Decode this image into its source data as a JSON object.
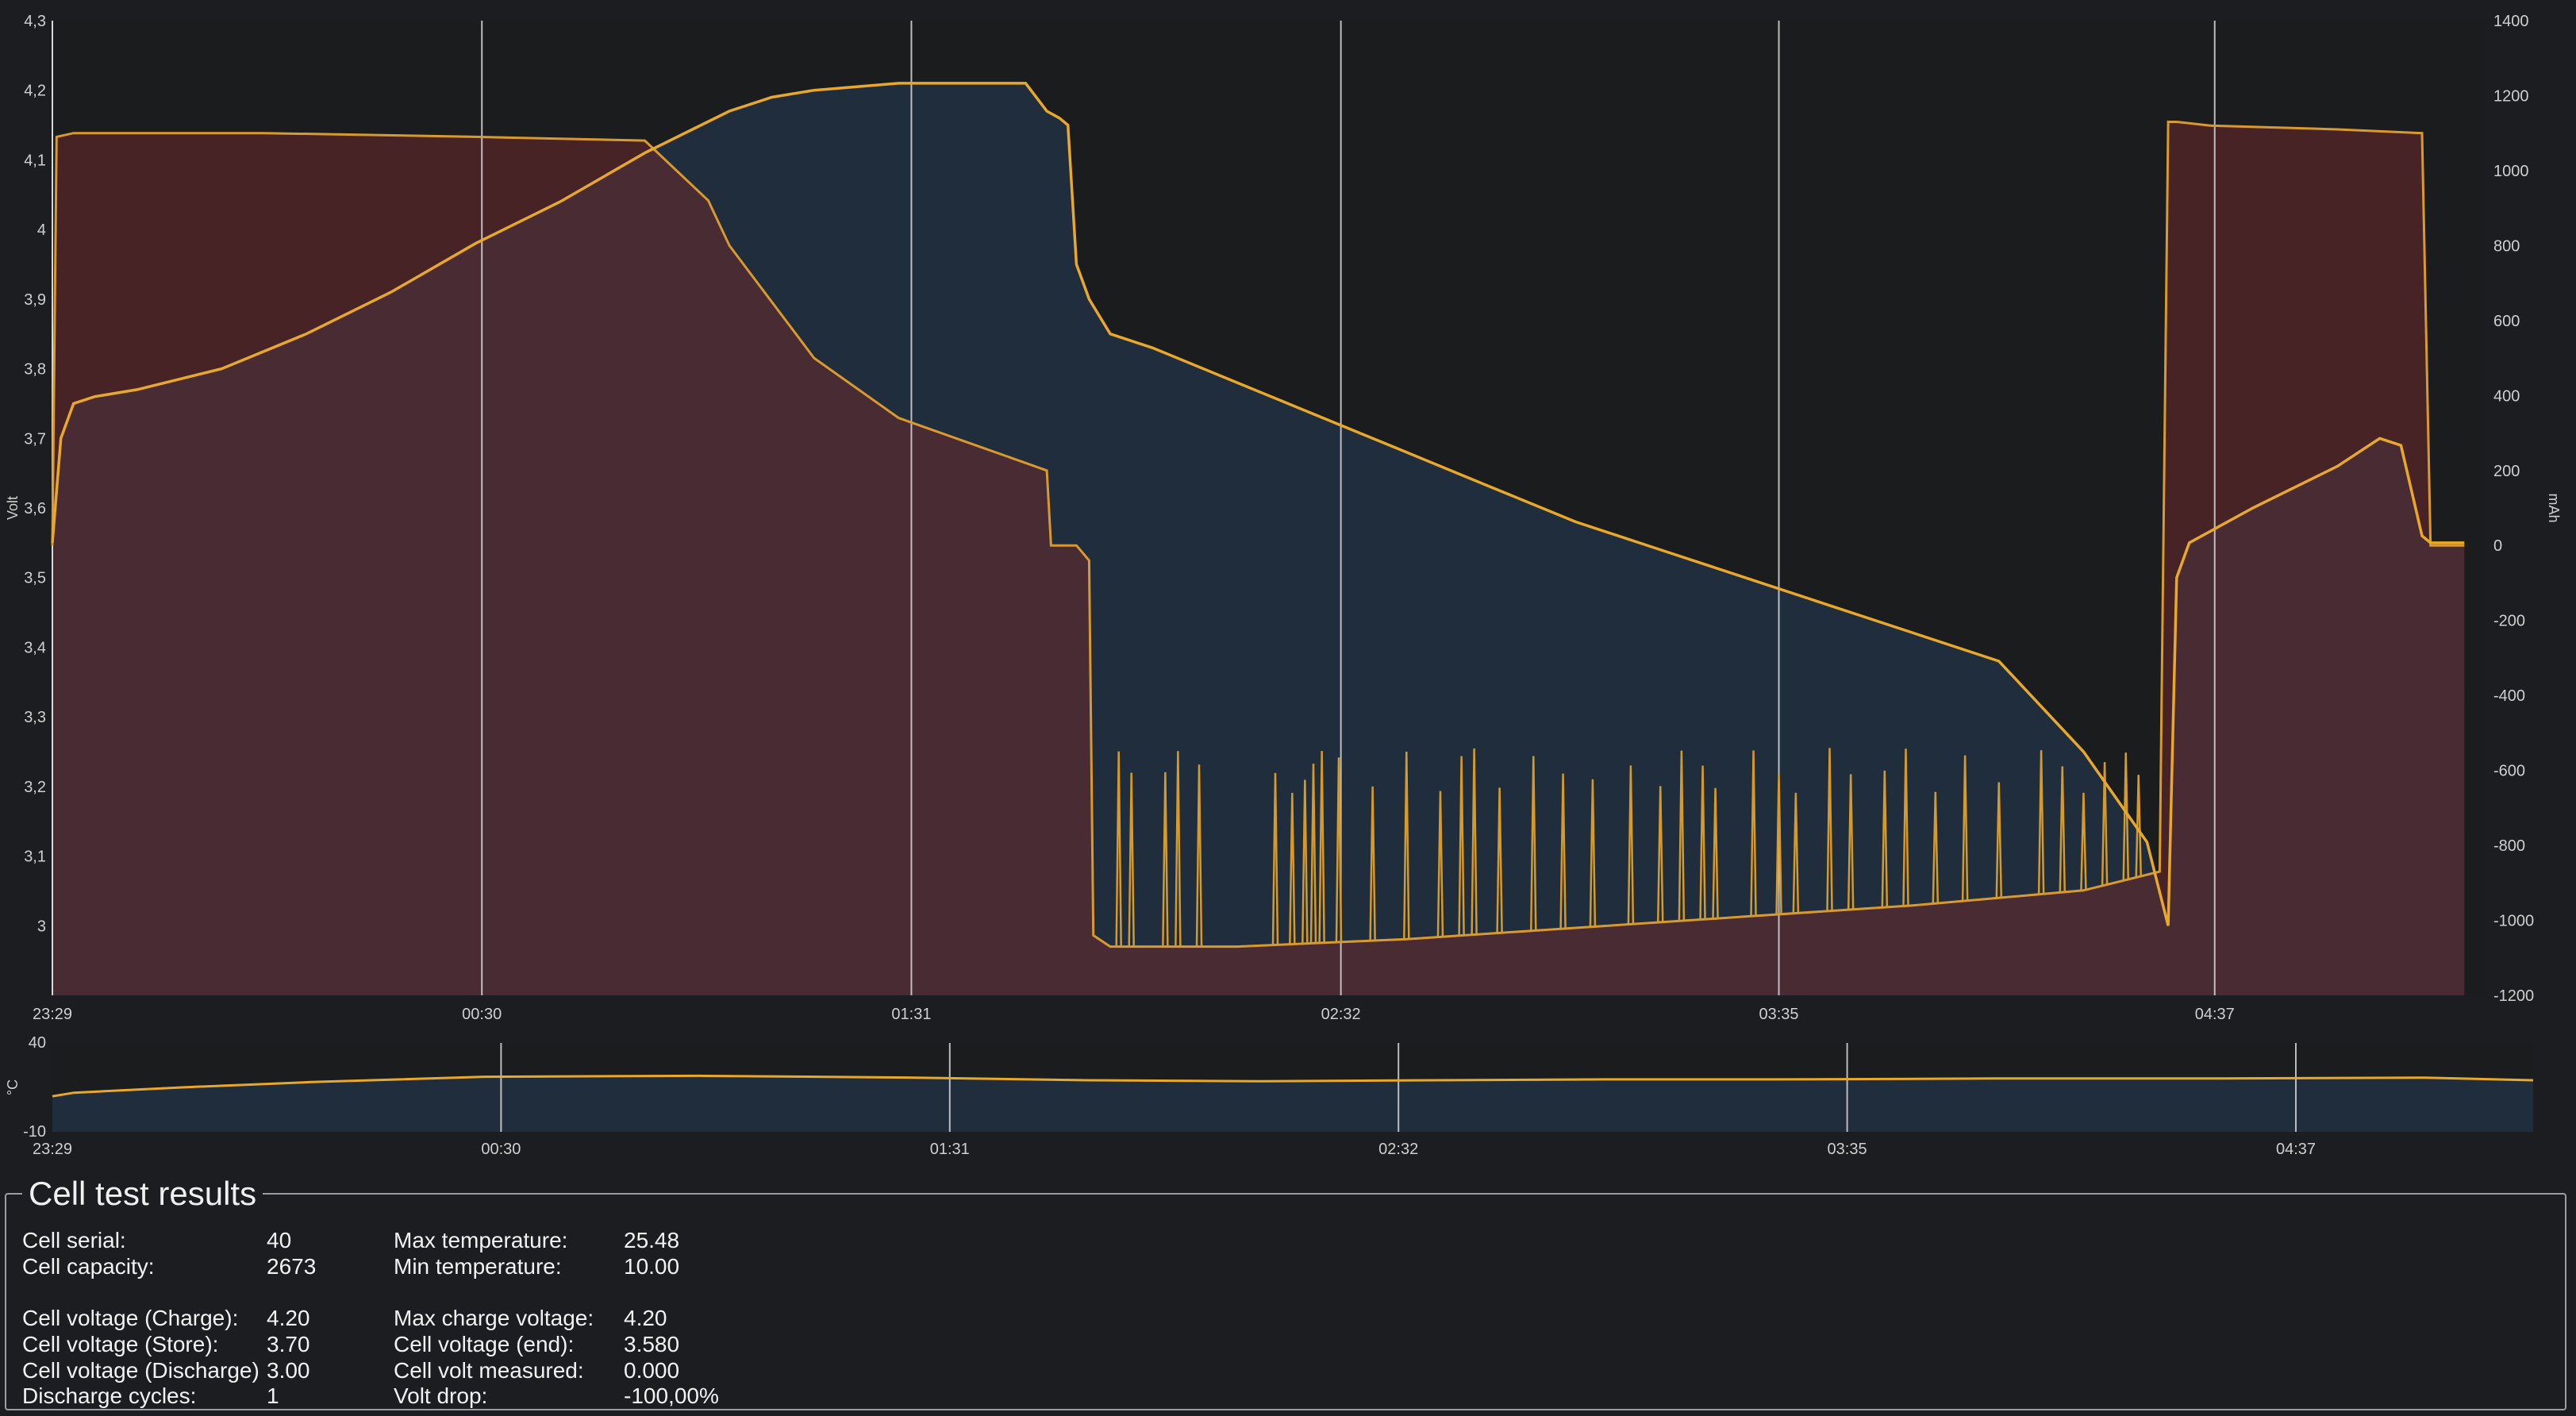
{
  "chart_data": [
    {
      "type": "line",
      "title": "",
      "x_labels": [
        "23:29",
        "00:30",
        "01:31",
        "02:32",
        "03:35",
        "04:37"
      ],
      "x_range_hours": [
        0,
        5.75
      ],
      "left_axis": {
        "label": "Volt",
        "ylim": [
          2.9,
          4.3
        ],
        "ticks": [
          "3",
          "3,1",
          "3,2",
          "3,3",
          "3,4",
          "3,5",
          "3,6",
          "3,7",
          "3,8",
          "3,9",
          "4",
          "4,1",
          "4,2",
          "4,3"
        ]
      },
      "right_axis": {
        "label": "mAh",
        "ylim": [
          -1200,
          1400
        ],
        "ticks": [
          "-1200",
          "-1000",
          "-800",
          "-600",
          "-400",
          "-200",
          "0",
          "200",
          "400",
          "600",
          "800",
          "1000",
          "1200",
          "1400"
        ]
      },
      "grid": "vertical",
      "series": [
        {
          "axis": "left",
          "color": "#e8a82c",
          "x": [
            0.0,
            0.02,
            0.05,
            0.1,
            0.2,
            0.4,
            0.6,
            0.8,
            1.0,
            1.2,
            1.4,
            1.6,
            1.7,
            1.8,
            2.0,
            2.2,
            2.3,
            2.35,
            2.38,
            2.4,
            2.42,
            2.45,
            2.5,
            2.6,
            2.8,
            3.0,
            3.2,
            3.4,
            3.6,
            3.8,
            4.0,
            4.2,
            4.4,
            4.6,
            4.8,
            4.95,
            5.0,
            5.02,
            5.05,
            5.2,
            5.4,
            5.5,
            5.55,
            5.6,
            5.62,
            5.65,
            5.7
          ],
          "y": [
            3.55,
            3.7,
            3.75,
            3.76,
            3.77,
            3.8,
            3.85,
            3.91,
            3.98,
            4.04,
            4.11,
            4.17,
            4.19,
            4.2,
            4.21,
            4.21,
            4.21,
            4.17,
            4.16,
            4.15,
            3.95,
            3.9,
            3.85,
            3.83,
            3.78,
            3.73,
            3.68,
            3.63,
            3.58,
            3.54,
            3.5,
            3.46,
            3.42,
            3.38,
            3.25,
            3.12,
            3.0,
            3.5,
            3.55,
            3.6,
            3.66,
            3.7,
            3.69,
            3.56,
            3.55,
            3.55,
            3.55
          ]
        },
        {
          "axis": "right",
          "color": "#d89a2f",
          "name": "",
          "x": [
            0.0,
            0.01,
            0.05,
            0.5,
            1.0,
            1.4,
            1.55,
            1.6,
            1.8,
            2.0,
            2.2,
            2.3,
            2.35,
            2.36,
            2.42,
            2.45,
            2.46,
            2.5,
            2.8,
            3.2,
            3.6,
            4.0,
            4.4,
            4.8,
            4.98,
            5.0,
            5.02,
            5.1,
            5.4,
            5.6,
            5.62,
            5.63,
            5.7
          ],
          "y": [
            0,
            1090,
            1100,
            1100,
            1090,
            1080,
            920,
            800,
            500,
            340,
            260,
            220,
            200,
            0,
            0,
            -40,
            -1040,
            -1070,
            -1070,
            -1050,
            -1020,
            -990,
            -960,
            -920,
            -870,
            1130,
            1130,
            1120,
            1110,
            1100,
            0,
            0,
            0
          ]
        }
      ],
      "spikes_right_axis_top": -600
    },
    {
      "type": "area",
      "x_labels": [
        "23:29",
        "00:30",
        "01:31",
        "02:32",
        "03:35",
        "04:37"
      ],
      "left_axis": {
        "label": "°C",
        "ylim": [
          -10,
          40
        ],
        "ticks": [
          "-10",
          "40"
        ]
      },
      "series": [
        {
          "color": "#e8a82c",
          "x": [
            0.0,
            0.05,
            0.3,
            0.6,
            1.0,
            1.5,
            2.0,
            2.4,
            2.8,
            3.2,
            3.6,
            4.0,
            4.5,
            5.0,
            5.5,
            5.75
          ],
          "y": [
            10,
            12,
            15,
            18,
            21,
            21.5,
            20.5,
            19,
            18.5,
            19,
            19.5,
            19.5,
            20,
            20,
            20.5,
            19
          ]
        }
      ]
    }
  ],
  "results": {
    "title": "Cell test results",
    "rows": [
      {
        "label": "Cell serial:",
        "value": "40"
      },
      {
        "label": "Cell capacity:",
        "value": "2673"
      },
      {
        "label": "Cell voltage (Charge):",
        "value": "4.20"
      },
      {
        "label": "Cell voltage (Store):",
        "value": "3.70"
      },
      {
        "label": "Cell voltage (Discharge)",
        "value": "3.00"
      },
      {
        "label": "Discharge cycles:",
        "value": "1"
      },
      {
        "label": "Max temperature:",
        "value": "25.48"
      },
      {
        "label": "Min temperature:",
        "value": "10.00"
      },
      {
        "label": "Max charge voltage:",
        "value": "4.20"
      },
      {
        "label": "Cell voltage (end):",
        "value": "3.580"
      },
      {
        "label": "Cell volt measured:",
        "value": "0.000"
      },
      {
        "label": "Volt drop:",
        "value": "-100,00%"
      }
    ]
  }
}
